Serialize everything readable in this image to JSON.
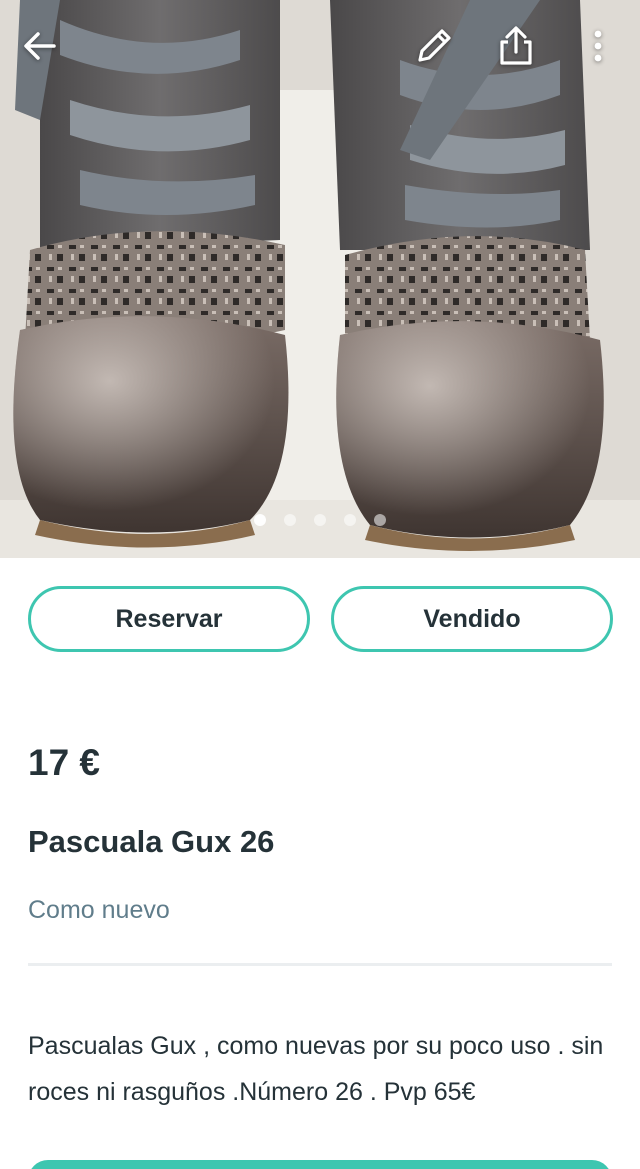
{
  "header": {
    "back_icon": "arrow-left-icon",
    "edit_icon": "pencil-icon",
    "share_icon": "share-icon",
    "more_icon": "more-vertical-icon"
  },
  "gallery": {
    "image_count": 5,
    "current_index": 1,
    "description": "brown leather boots with grey satin laces"
  },
  "actions": {
    "reserve_label": "Reservar",
    "sold_label": "Vendido",
    "accent_color": "#3ec6b0"
  },
  "product": {
    "price": "17 €",
    "title": "Pascuala Gux 26",
    "condition": "Como nuevo",
    "description": "Pascualas Gux , como nuevas por su poco uso . sin roces ni rasguños .Número 26 . Pvp 65€"
  }
}
